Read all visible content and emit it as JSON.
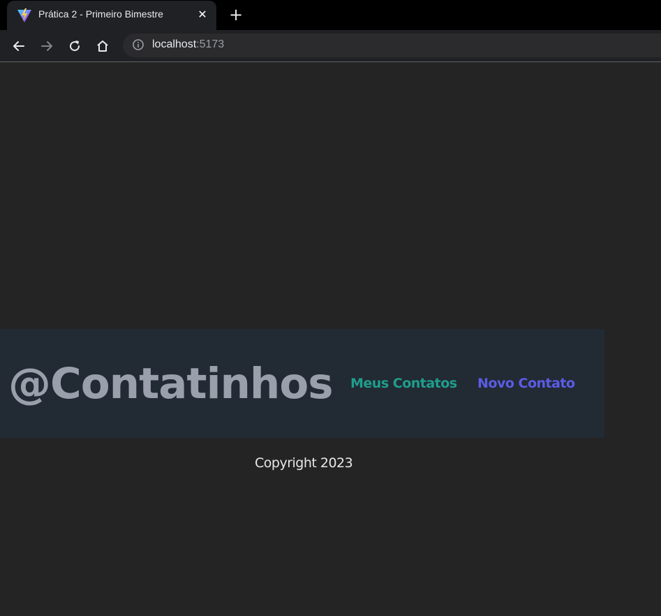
{
  "browser": {
    "tab": {
      "title": "Prática 2 - Primeiro Bimestre",
      "favicon": "vite-logo-icon",
      "close_symbol": "✕"
    },
    "new_tab_symbol": "+",
    "url": {
      "host": "localhost",
      "port": ":5173"
    }
  },
  "page": {
    "brand": "@Contatinhos",
    "nav": [
      {
        "label": "Meus Contatos",
        "color": "#1f9e8b"
      },
      {
        "label": "Novo Contato",
        "color": "#5c5ce6"
      }
    ],
    "footer": "Copyright 2023"
  },
  "colors": {
    "page_background": "#242424",
    "header_background": "#222a34",
    "brand_text": "#9aa0ab"
  }
}
